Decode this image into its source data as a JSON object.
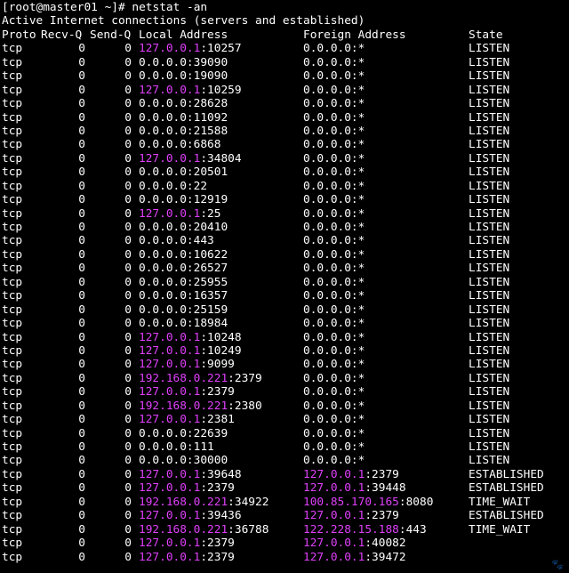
{
  "terminal": {
    "prompt": "[root@master01 ~]# netstat -an",
    "summary": "Active Internet connections (servers and established)",
    "headers": {
      "proto": "Proto",
      "recvq": "Recv-Q",
      "sendq": "Send-Q",
      "local": "Local Address",
      "foreign": "Foreign Address",
      "state": "State"
    },
    "highlight_color": "#e040fb",
    "rows": [
      {
        "proto": "tcp",
        "recvq": "0",
        "sendq": "0",
        "local_ip": "127.0.0.1",
        "local_port": ":10257",
        "foreign_ip": "",
        "foreign_port": "0.0.0.0:*",
        "state": "LISTEN"
      },
      {
        "proto": "tcp",
        "recvq": "0",
        "sendq": "0",
        "local_ip": "",
        "local_port": "0.0.0.0:39090",
        "foreign_ip": "",
        "foreign_port": "0.0.0.0:*",
        "state": "LISTEN"
      },
      {
        "proto": "tcp",
        "recvq": "0",
        "sendq": "0",
        "local_ip": "",
        "local_port": "0.0.0.0:19090",
        "foreign_ip": "",
        "foreign_port": "0.0.0.0:*",
        "state": "LISTEN"
      },
      {
        "proto": "tcp",
        "recvq": "0",
        "sendq": "0",
        "local_ip": "127.0.0.1",
        "local_port": ":10259",
        "foreign_ip": "",
        "foreign_port": "0.0.0.0:*",
        "state": "LISTEN"
      },
      {
        "proto": "tcp",
        "recvq": "0",
        "sendq": "0",
        "local_ip": "",
        "local_port": "0.0.0.0:28628",
        "foreign_ip": "",
        "foreign_port": "0.0.0.0:*",
        "state": "LISTEN"
      },
      {
        "proto": "tcp",
        "recvq": "0",
        "sendq": "0",
        "local_ip": "",
        "local_port": "0.0.0.0:11092",
        "foreign_ip": "",
        "foreign_port": "0.0.0.0:*",
        "state": "LISTEN"
      },
      {
        "proto": "tcp",
        "recvq": "0",
        "sendq": "0",
        "local_ip": "",
        "local_port": "0.0.0.0:21588",
        "foreign_ip": "",
        "foreign_port": "0.0.0.0:*",
        "state": "LISTEN"
      },
      {
        "proto": "tcp",
        "recvq": "0",
        "sendq": "0",
        "local_ip": "",
        "local_port": "0.0.0.0:6868",
        "foreign_ip": "",
        "foreign_port": "0.0.0.0:*",
        "state": "LISTEN"
      },
      {
        "proto": "tcp",
        "recvq": "0",
        "sendq": "0",
        "local_ip": "127.0.0.1",
        "local_port": ":34804",
        "foreign_ip": "",
        "foreign_port": "0.0.0.0:*",
        "state": "LISTEN"
      },
      {
        "proto": "tcp",
        "recvq": "0",
        "sendq": "0",
        "local_ip": "",
        "local_port": "0.0.0.0:20501",
        "foreign_ip": "",
        "foreign_port": "0.0.0.0:*",
        "state": "LISTEN"
      },
      {
        "proto": "tcp",
        "recvq": "0",
        "sendq": "0",
        "local_ip": "",
        "local_port": "0.0.0.0:22",
        "foreign_ip": "",
        "foreign_port": "0.0.0.0:*",
        "state": "LISTEN"
      },
      {
        "proto": "tcp",
        "recvq": "0",
        "sendq": "0",
        "local_ip": "",
        "local_port": "0.0.0.0:12919",
        "foreign_ip": "",
        "foreign_port": "0.0.0.0:*",
        "state": "LISTEN"
      },
      {
        "proto": "tcp",
        "recvq": "0",
        "sendq": "0",
        "local_ip": "127.0.0.1",
        "local_port": ":25",
        "foreign_ip": "",
        "foreign_port": "0.0.0.0:*",
        "state": "LISTEN"
      },
      {
        "proto": "tcp",
        "recvq": "0",
        "sendq": "0",
        "local_ip": "",
        "local_port": "0.0.0.0:20410",
        "foreign_ip": "",
        "foreign_port": "0.0.0.0:*",
        "state": "LISTEN"
      },
      {
        "proto": "tcp",
        "recvq": "0",
        "sendq": "0",
        "local_ip": "",
        "local_port": "0.0.0.0:443",
        "foreign_ip": "",
        "foreign_port": "0.0.0.0:*",
        "state": "LISTEN"
      },
      {
        "proto": "tcp",
        "recvq": "0",
        "sendq": "0",
        "local_ip": "",
        "local_port": "0.0.0.0:10622",
        "foreign_ip": "",
        "foreign_port": "0.0.0.0:*",
        "state": "LISTEN"
      },
      {
        "proto": "tcp",
        "recvq": "0",
        "sendq": "0",
        "local_ip": "",
        "local_port": "0.0.0.0:26527",
        "foreign_ip": "",
        "foreign_port": "0.0.0.0:*",
        "state": "LISTEN"
      },
      {
        "proto": "tcp",
        "recvq": "0",
        "sendq": "0",
        "local_ip": "",
        "local_port": "0.0.0.0:25955",
        "foreign_ip": "",
        "foreign_port": "0.0.0.0:*",
        "state": "LISTEN"
      },
      {
        "proto": "tcp",
        "recvq": "0",
        "sendq": "0",
        "local_ip": "",
        "local_port": "0.0.0.0:16357",
        "foreign_ip": "",
        "foreign_port": "0.0.0.0:*",
        "state": "LISTEN"
      },
      {
        "proto": "tcp",
        "recvq": "0",
        "sendq": "0",
        "local_ip": "",
        "local_port": "0.0.0.0:25159",
        "foreign_ip": "",
        "foreign_port": "0.0.0.0:*",
        "state": "LISTEN"
      },
      {
        "proto": "tcp",
        "recvq": "0",
        "sendq": "0",
        "local_ip": "",
        "local_port": "0.0.0.0:18984",
        "foreign_ip": "",
        "foreign_port": "0.0.0.0:*",
        "state": "LISTEN"
      },
      {
        "proto": "tcp",
        "recvq": "0",
        "sendq": "0",
        "local_ip": "127.0.0.1",
        "local_port": ":10248",
        "foreign_ip": "",
        "foreign_port": "0.0.0.0:*",
        "state": "LISTEN"
      },
      {
        "proto": "tcp",
        "recvq": "0",
        "sendq": "0",
        "local_ip": "127.0.0.1",
        "local_port": ":10249",
        "foreign_ip": "",
        "foreign_port": "0.0.0.0:*",
        "state": "LISTEN"
      },
      {
        "proto": "tcp",
        "recvq": "0",
        "sendq": "0",
        "local_ip": "127.0.0.1",
        "local_port": ":9099",
        "foreign_ip": "",
        "foreign_port": "0.0.0.0:*",
        "state": "LISTEN"
      },
      {
        "proto": "tcp",
        "recvq": "0",
        "sendq": "0",
        "local_ip": "192.168.0.221",
        "local_port": ":2379",
        "foreign_ip": "",
        "foreign_port": "0.0.0.0:*",
        "state": "LISTEN"
      },
      {
        "proto": "tcp",
        "recvq": "0",
        "sendq": "0",
        "local_ip": "127.0.0.1",
        "local_port": ":2379",
        "foreign_ip": "",
        "foreign_port": "0.0.0.0:*",
        "state": "LISTEN"
      },
      {
        "proto": "tcp",
        "recvq": "0",
        "sendq": "0",
        "local_ip": "192.168.0.221",
        "local_port": ":2380",
        "foreign_ip": "",
        "foreign_port": "0.0.0.0:*",
        "state": "LISTEN"
      },
      {
        "proto": "tcp",
        "recvq": "0",
        "sendq": "0",
        "local_ip": "127.0.0.1",
        "local_port": ":2381",
        "foreign_ip": "",
        "foreign_port": "0.0.0.0:*",
        "state": "LISTEN"
      },
      {
        "proto": "tcp",
        "recvq": "0",
        "sendq": "0",
        "local_ip": "",
        "local_port": "0.0.0.0:22639",
        "foreign_ip": "",
        "foreign_port": "0.0.0.0:*",
        "state": "LISTEN"
      },
      {
        "proto": "tcp",
        "recvq": "0",
        "sendq": "0",
        "local_ip": "",
        "local_port": "0.0.0.0:111",
        "foreign_ip": "",
        "foreign_port": "0.0.0.0:*",
        "state": "LISTEN"
      },
      {
        "proto": "tcp",
        "recvq": "0",
        "sendq": "0",
        "local_ip": "",
        "local_port": "0.0.0.0:30000",
        "foreign_ip": "",
        "foreign_port": "0.0.0.0:*",
        "state": "LISTEN"
      },
      {
        "proto": "tcp",
        "recvq": "0",
        "sendq": "0",
        "local_ip": "127.0.0.1",
        "local_port": ":39648",
        "foreign_ip": "127.0.0.1",
        "foreign_port": ":2379",
        "state": "ESTABLISHED"
      },
      {
        "proto": "tcp",
        "recvq": "0",
        "sendq": "0",
        "local_ip": "127.0.0.1",
        "local_port": ":2379",
        "foreign_ip": "127.0.0.1",
        "foreign_port": ":39448",
        "state": "ESTABLISHED"
      },
      {
        "proto": "tcp",
        "recvq": "0",
        "sendq": "0",
        "local_ip": "192.168.0.221",
        "local_port": ":34922",
        "foreign_ip": "100.85.170.165",
        "foreign_port": ":8080",
        "state": "TIME_WAIT"
      },
      {
        "proto": "tcp",
        "recvq": "0",
        "sendq": "0",
        "local_ip": "127.0.0.1",
        "local_port": ":39436",
        "foreign_ip": "127.0.0.1",
        "foreign_port": ":2379",
        "state": "ESTABLISHED"
      },
      {
        "proto": "tcp",
        "recvq": "0",
        "sendq": "0",
        "local_ip": "192.168.0.221",
        "local_port": ":36788",
        "foreign_ip": "122.228.15.188",
        "foreign_port": ":443",
        "state": "TIME_WAIT"
      },
      {
        "proto": "tcp",
        "recvq": "0",
        "sendq": "0",
        "local_ip": "127.0.0.1",
        "local_port": ":2379",
        "foreign_ip": "127.0.0.1",
        "foreign_port": ":40082",
        "state": ""
      },
      {
        "proto": "tcp",
        "recvq": "0",
        "sendq": "0",
        "local_ip": "127.0.0.1",
        "local_port": ":2379",
        "foreign_ip": "127.0.0.1",
        "foreign_port": ":39472",
        "state": ""
      }
    ]
  }
}
